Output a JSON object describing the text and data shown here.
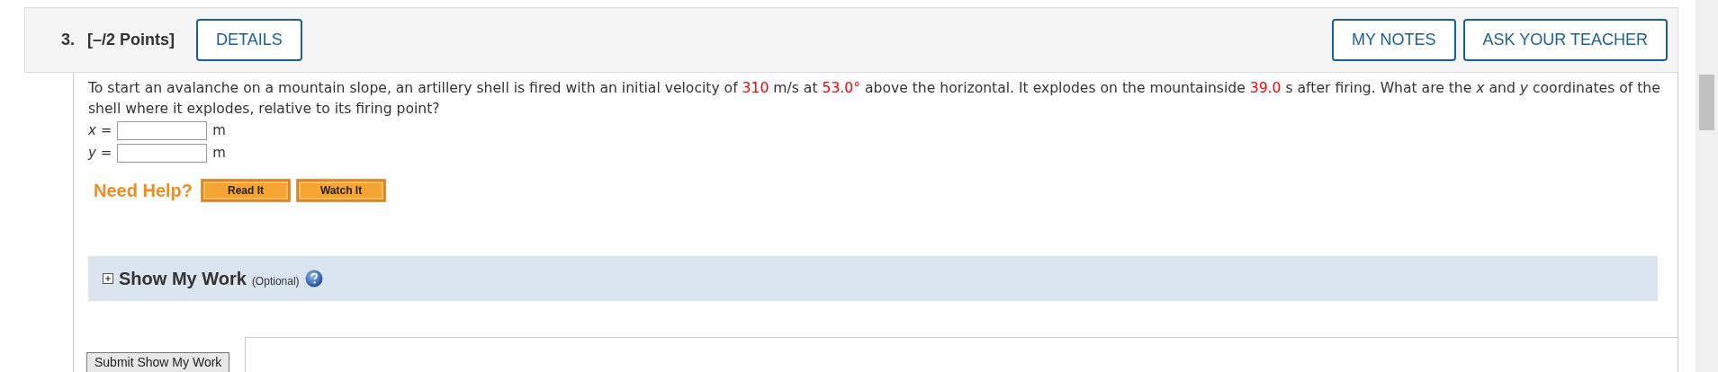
{
  "question": {
    "number": "3.",
    "points": "[–/2 Points]"
  },
  "header_buttons_left": [
    "DETAILS"
  ],
  "header_buttons_right": [
    "MY NOTES",
    "ASK YOUR TEACHER"
  ],
  "prompt": [
    {
      "kind": "plain",
      "text": "To start an avalanche on a mountain slope, an artillery shell is fired with an initial velocity of "
    },
    {
      "kind": "value",
      "text": "310"
    },
    {
      "kind": "plain",
      "text": " m/s at "
    },
    {
      "kind": "value",
      "text": "53.0°"
    },
    {
      "kind": "plain",
      "text": " above the horizontal. It explodes on the mountainside "
    },
    {
      "kind": "value",
      "text": "39.0"
    },
    {
      "kind": "plain",
      "text": " s after firing. What are the *x* and *y* coordinates of the shell where it explodes, relative to its firing point?"
    }
  ],
  "answers": [
    {
      "variable": "x",
      "equals": "=",
      "unit": "m"
    },
    {
      "variable": "y",
      "equals": "=",
      "unit": "m"
    }
  ],
  "help": {
    "label": "Need Help?",
    "buttons": [
      "Read It",
      "Watch It"
    ]
  },
  "show_my_work": {
    "expanded": false,
    "title": "Show My Work",
    "note": "(Optional)"
  },
  "submit_button": "Submit Show My Work"
}
